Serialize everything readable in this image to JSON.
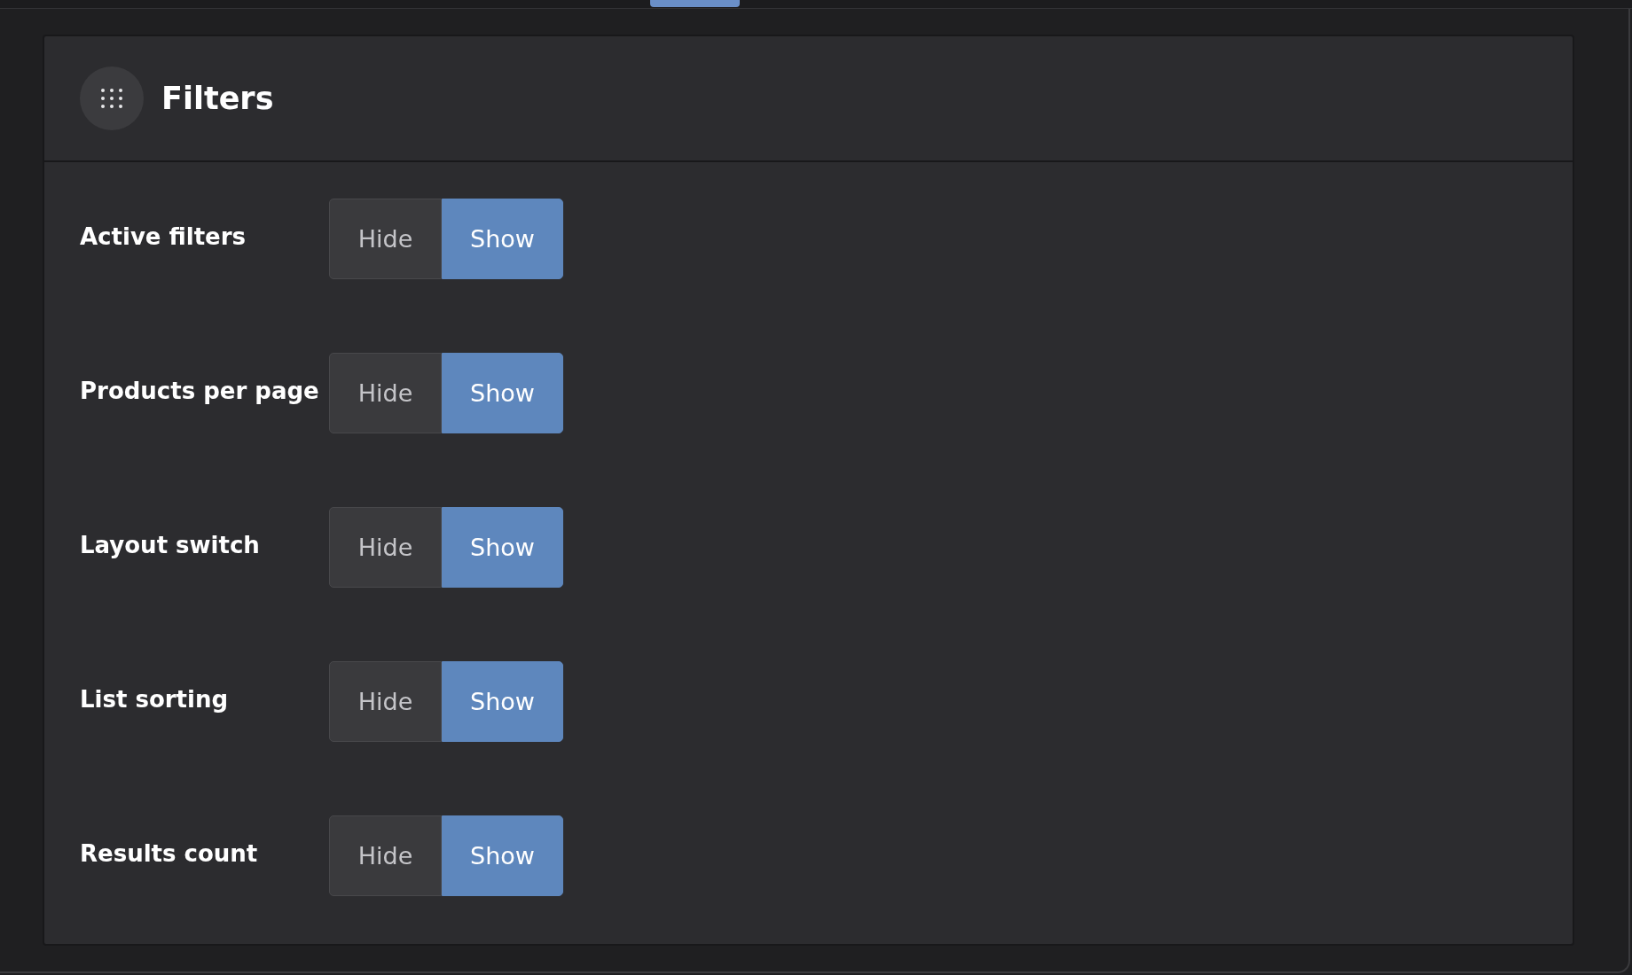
{
  "panel": {
    "title": "Filters"
  },
  "settings": [
    {
      "label": "Active filters",
      "options": [
        {
          "label": "Hide",
          "selected": false
        },
        {
          "label": "Show",
          "selected": true
        }
      ]
    },
    {
      "label": "Products per page",
      "options": [
        {
          "label": "Hide",
          "selected": false
        },
        {
          "label": "Show",
          "selected": true
        }
      ]
    },
    {
      "label": "Layout switch",
      "options": [
        {
          "label": "Hide",
          "selected": false
        },
        {
          "label": "Show",
          "selected": true
        }
      ]
    },
    {
      "label": "List sorting",
      "options": [
        {
          "label": "Hide",
          "selected": false
        },
        {
          "label": "Show",
          "selected": true
        }
      ]
    },
    {
      "label": "Results count",
      "options": [
        {
          "label": "Hide",
          "selected": false
        },
        {
          "label": "Show",
          "selected": true
        }
      ]
    }
  ]
}
